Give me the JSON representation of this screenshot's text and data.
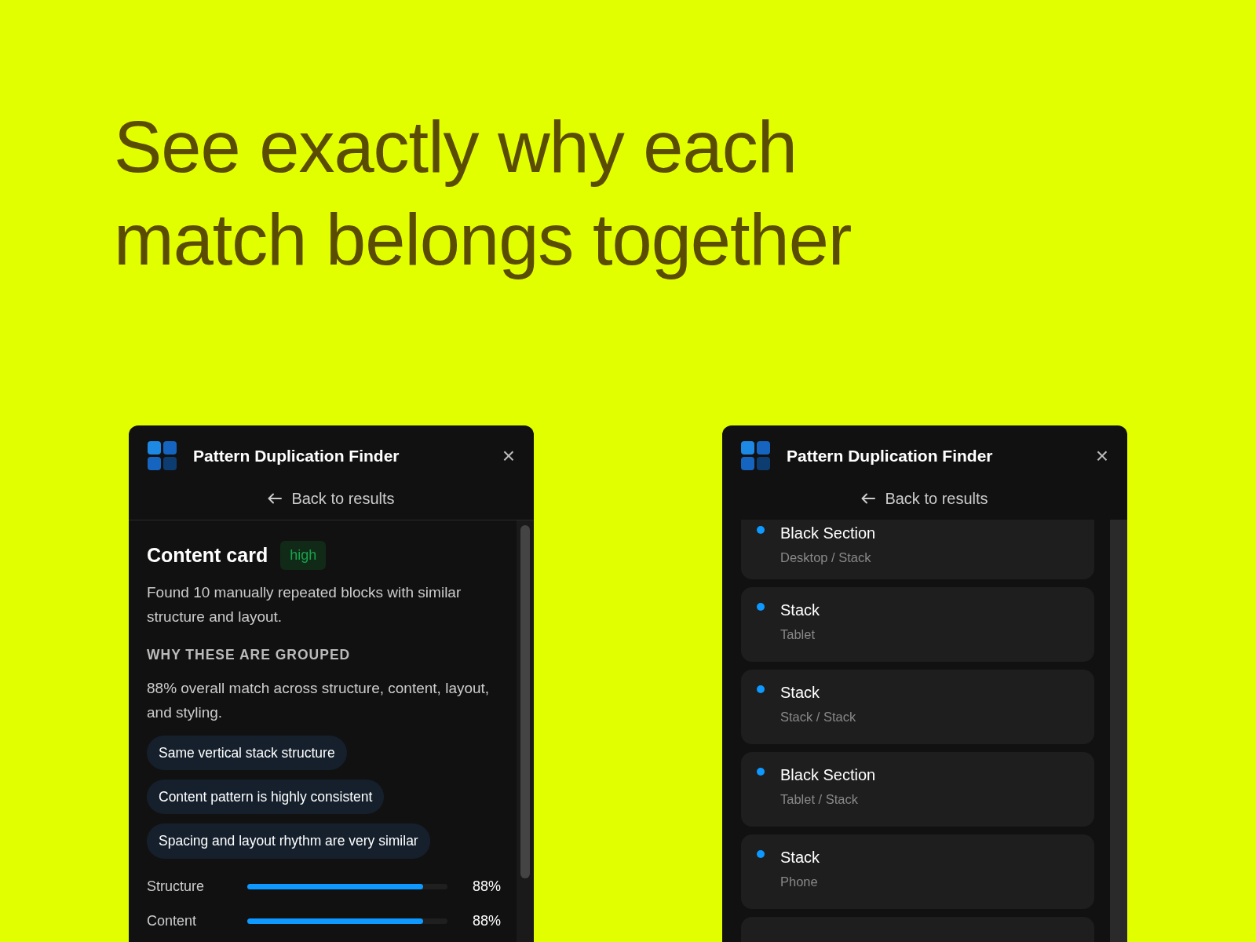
{
  "headline": "See exactly why each match belongs together",
  "panels": [
    {
      "kind": "detail",
      "title": "Pattern Duplication Finder",
      "close": "×",
      "back": "Back to results",
      "pattern": {
        "name": "Content card",
        "confidence": "high",
        "description": "Found 10 manually repeated blocks with similar structure and layout.",
        "section_heading": "WHY THESE ARE GROUPED",
        "summary": "88% overall match across structure, content, layout, and styling.",
        "reasons": [
          "Same vertical stack structure",
          "Content pattern is highly consistent",
          "Spacing and layout rhythm are very similar"
        ],
        "metrics": [
          {
            "label": "Structure",
            "level": 0.88,
            "reading": "88%"
          },
          {
            "label": "Content",
            "level": 0.88,
            "reading": "88%"
          }
        ]
      }
    },
    {
      "kind": "list",
      "title": "Pattern Duplication Finder",
      "close": "×",
      "back": "Back to results",
      "items": [
        {
          "name": "Black Section",
          "path": "Desktop / Stack"
        },
        {
          "name": "Stack",
          "path": "Tablet"
        },
        {
          "name": "Stack",
          "path": "Stack / Stack"
        },
        {
          "name": "Black Section",
          "path": "Tablet / Stack"
        },
        {
          "name": "Stack",
          "path": "Phone"
        }
      ]
    }
  ]
}
